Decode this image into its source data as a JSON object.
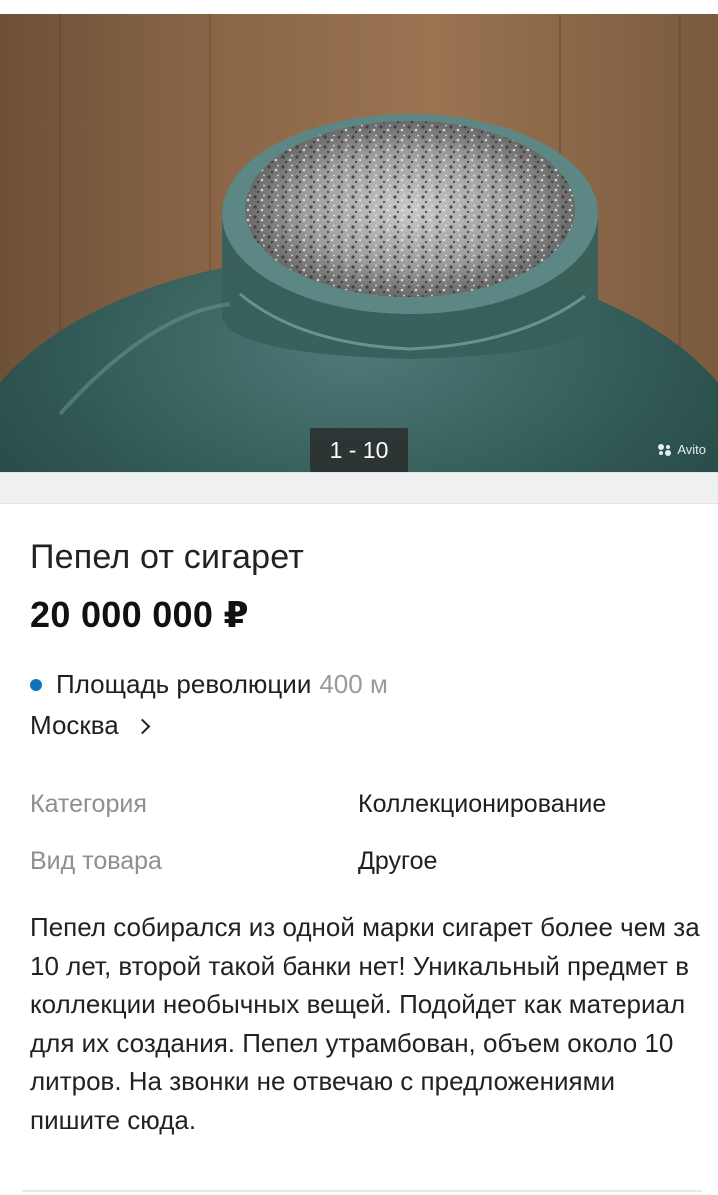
{
  "gallery": {
    "counter": "1 - 10",
    "watermark": "Avito"
  },
  "listing": {
    "title": "Пепел от сигарет",
    "price": "20 000 000 ₽",
    "location": {
      "metro_station": "Площадь революции",
      "metro_distance": "400 м",
      "metro_color": "#0f74bc",
      "city": "Москва"
    },
    "params": [
      {
        "label": "Категория",
        "value": "Коллекционирование"
      },
      {
        "label": "Вид товара",
        "value": "Другое"
      }
    ],
    "description": "Пепел собирался из одной марки сигарет более чем за 10 лет, второй такой банки нет! Уникальный предмет в коллекции необычных вещей. Подойдет как материал для их создания. Пепел утрамбован, объем около 10 литров. На звонки не отвечаю с предложениями пишите сюда."
  }
}
